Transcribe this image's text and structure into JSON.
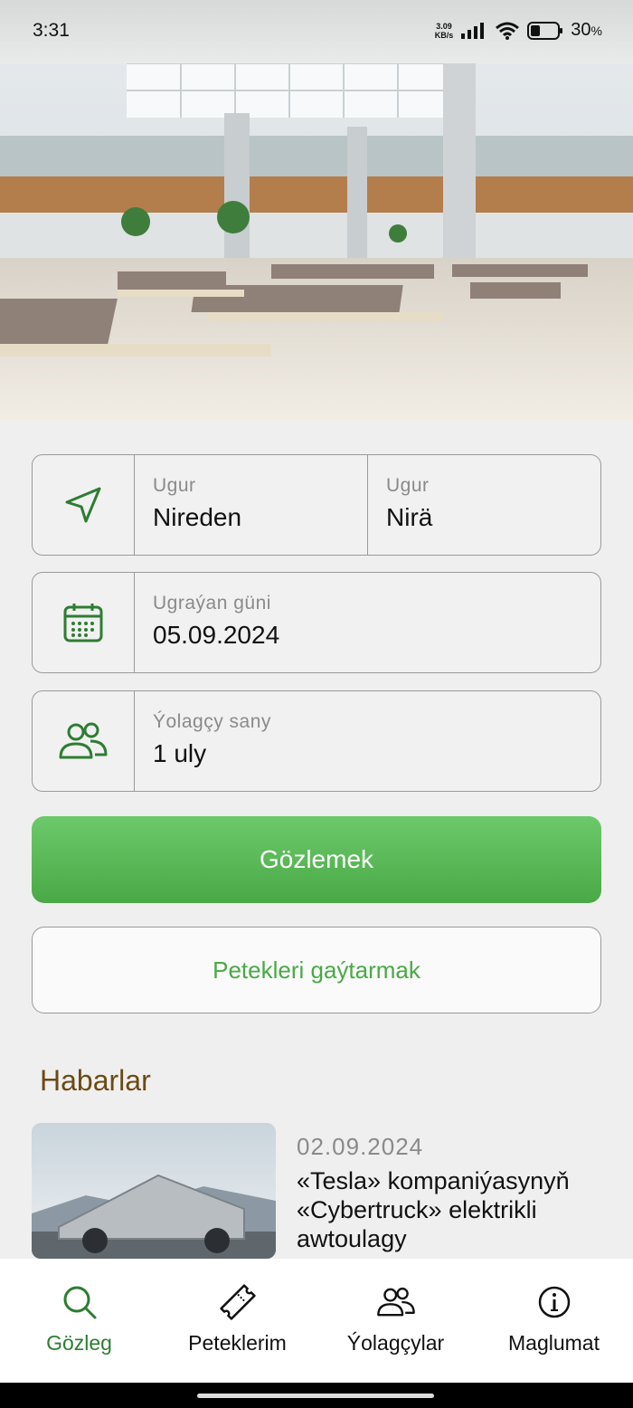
{
  "status_bar": {
    "time": "3:31",
    "net_speed": "3.09",
    "net_unit": "KB/s",
    "battery": "30",
    "battery_unit": "%"
  },
  "form": {
    "from": {
      "label": "Ugur",
      "value": "Nireden"
    },
    "to": {
      "label": "Ugur",
      "value": "Nirä"
    },
    "date": {
      "label": "Ugraýan güni",
      "value": "05.09.2024"
    },
    "passengers": {
      "label": "Ýolagçy sany",
      "value": "1 uly"
    }
  },
  "buttons": {
    "search": "Gözlemek",
    "return_tickets": "Petekleri gaýtarmak"
  },
  "news": {
    "heading": "Habarlar",
    "items": [
      {
        "date": "02.09.2024",
        "title": "«Tesla» kompaniýasynyň «Cybertruck» elektrikli awtoulagy"
      }
    ]
  },
  "nav": {
    "items": [
      {
        "label": "Gözleg",
        "icon": "search-icon",
        "active": true
      },
      {
        "label": "Peteklerim",
        "icon": "ticket-icon",
        "active": false
      },
      {
        "label": "Ýolagçylar",
        "icon": "users-icon",
        "active": false
      },
      {
        "label": "Maglumat",
        "icon": "info-icon",
        "active": false
      }
    ]
  },
  "colors": {
    "accent": "#4aa946",
    "nav_active": "#2e7d32",
    "news_heading": "#6b4a14"
  }
}
